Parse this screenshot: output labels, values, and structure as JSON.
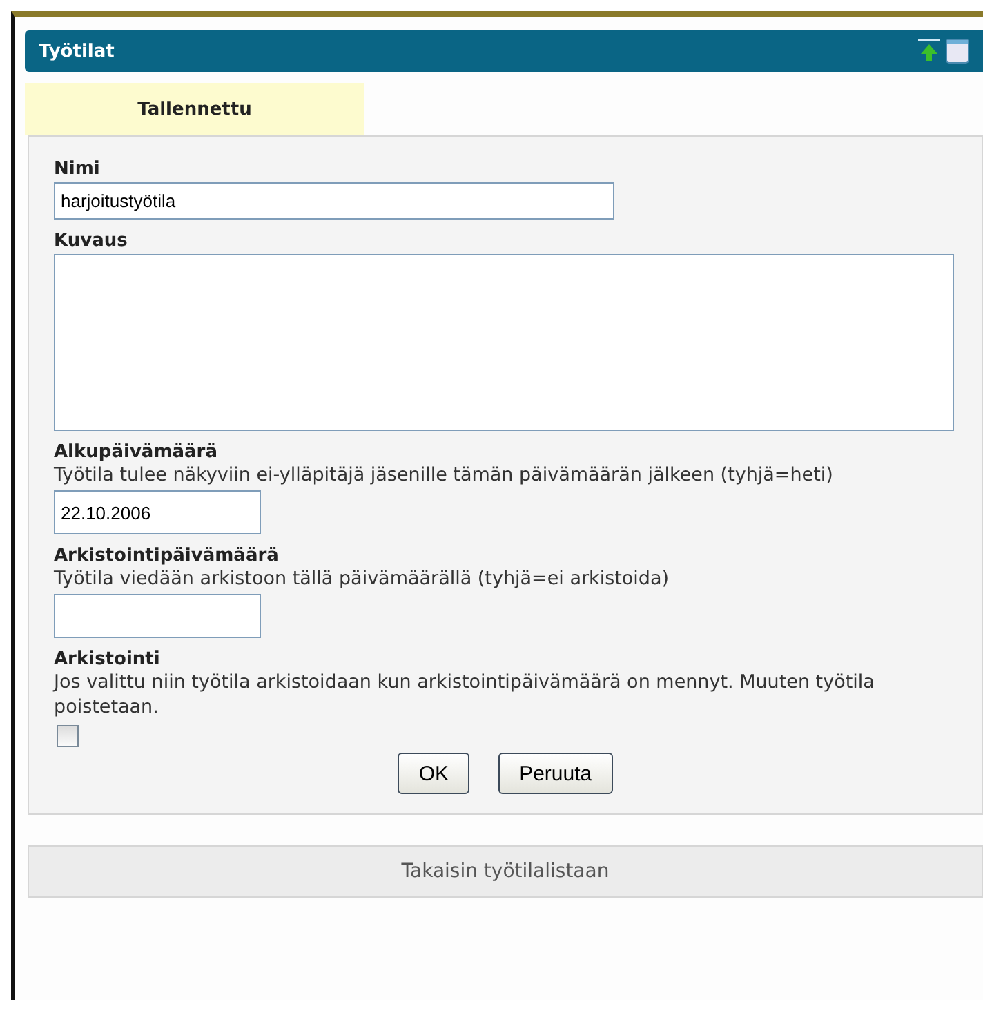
{
  "window": {
    "title": "Työtilat"
  },
  "tabs": [
    {
      "label": "Tallennettu",
      "selected": true
    }
  ],
  "fields": [
    {
      "kind": "text",
      "label": "Nimi",
      "value": "harjoitustyötila"
    },
    {
      "kind": "textarea",
      "label": "Kuvaus"
    },
    {
      "kind": "date",
      "label": "Alkupäivämäärä",
      "help": "Työtila tulee näkyviin ei-ylläpitäjä jäsenille tämän päivämäärän jälkeen (tyhjä=heti)",
      "value": "22.10.2006"
    },
    {
      "kind": "date",
      "label": "Arkistointipäivämäärä",
      "help": "Työtila viedään arkistoon tällä päivämäärällä (tyhjä=ei arkistoida)"
    },
    {
      "kind": "checkbox",
      "label": "Arkistointi",
      "help": "Jos valittu niin työtila arkistoidaan kun arkistointipäivämäärä on mennyt. Muuten työtila poistetaan.",
      "checked": false
    }
  ],
  "buttons": [
    "OK",
    "Peruuta"
  ],
  "back_link": "Takaisin työtilalistaan"
}
